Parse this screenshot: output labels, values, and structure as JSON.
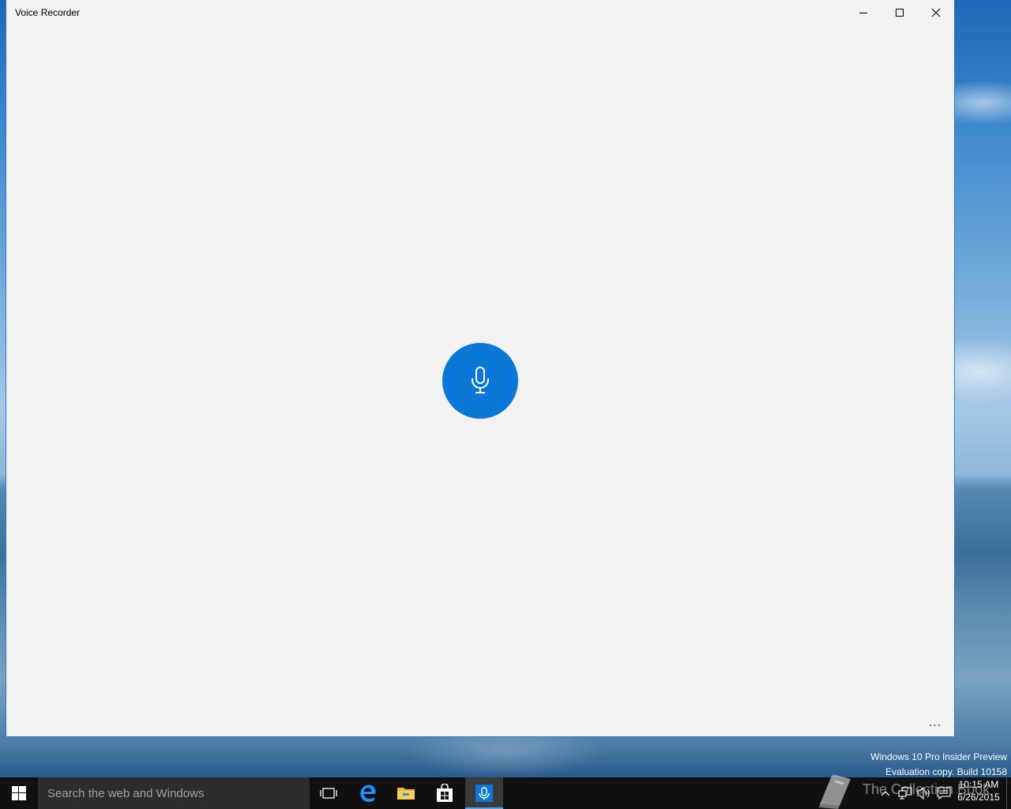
{
  "window": {
    "title": "Voice Recorder",
    "minimize_icon": "minimize-icon",
    "maximize_icon": "maximize-icon",
    "close_icon": "close-icon"
  },
  "main": {
    "record_button_icon": "microphone-icon",
    "more_label": "..."
  },
  "watermark": {
    "line1": "Windows 10 Pro Insider Preview",
    "line2": "Evaluation copy. Build 10158"
  },
  "taskbar": {
    "search_placeholder": "Search the web and Windows",
    "brand_text": "The Collection Book",
    "clock_time": "10:15 AM",
    "clock_date": "6/26/2015",
    "active_app": "Voice Recorder"
  },
  "colors": {
    "accent": "#0b78d7",
    "window_bg": "#f2f2f2",
    "taskbar_bg": "#101010",
    "search_bg": "#2c2c2c"
  }
}
